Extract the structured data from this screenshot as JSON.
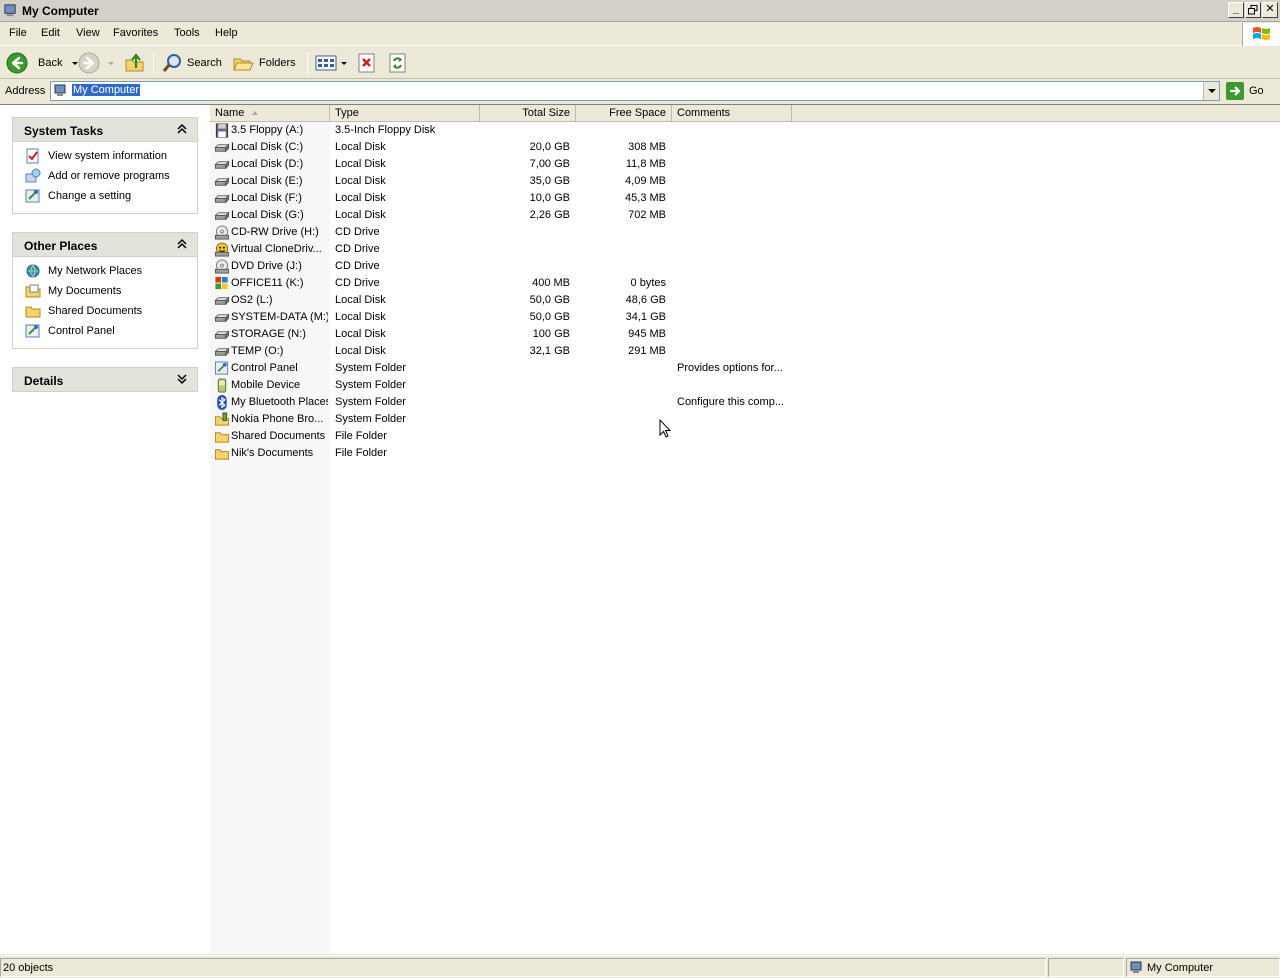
{
  "window": {
    "title": "My Computer"
  },
  "menu": [
    "File",
    "Edit",
    "View",
    "Favorites",
    "Tools",
    "Help"
  ],
  "toolbar": {
    "back_label": "Back",
    "search_label": "Search",
    "folders_label": "Folders"
  },
  "address": {
    "label": "Address",
    "value": "My Computer",
    "go_label": "Go"
  },
  "taskpane": {
    "system_tasks": {
      "title": "System Tasks",
      "links": [
        "View system information",
        "Add or remove programs",
        "Change a setting"
      ]
    },
    "other_places": {
      "title": "Other Places",
      "links": [
        "My Network Places",
        "My Documents",
        "Shared Documents",
        "Control Panel"
      ]
    },
    "details": {
      "title": "Details"
    }
  },
  "columns": {
    "name": "Name",
    "type": "Type",
    "total": "Total Size",
    "free": "Free Space",
    "comments": "Comments"
  },
  "items": [
    {
      "name": "3.5 Floppy (A:)",
      "type": "3.5-Inch Floppy Disk",
      "total": "",
      "free": "",
      "comments": "",
      "icon": "floppy-icon"
    },
    {
      "name": "Local Disk (C:)",
      "type": "Local Disk",
      "total": "20,0 GB",
      "free": "308 MB",
      "comments": "",
      "icon": "hard-disk-icon"
    },
    {
      "name": "Local Disk (D:)",
      "type": "Local Disk",
      "total": "7,00 GB",
      "free": "11,8 MB",
      "comments": "",
      "icon": "hard-disk-icon"
    },
    {
      "name": "Local Disk (E:)",
      "type": "Local Disk",
      "total": "35,0 GB",
      "free": "4,09 MB",
      "comments": "",
      "icon": "hard-disk-icon"
    },
    {
      "name": "Local Disk (F:)",
      "type": "Local Disk",
      "total": "10,0 GB",
      "free": "45,3 MB",
      "comments": "",
      "icon": "hard-disk-icon"
    },
    {
      "name": "Local Disk (G:)",
      "type": "Local Disk",
      "total": "2,26 GB",
      "free": "702 MB",
      "comments": "",
      "icon": "hard-disk-icon"
    },
    {
      "name": "CD-RW Drive (H:)",
      "type": "CD Drive",
      "total": "",
      "free": "",
      "comments": "",
      "icon": "cd-drive-icon"
    },
    {
      "name": "Virtual CloneDriv...",
      "type": "CD Drive",
      "total": "",
      "free": "",
      "comments": "",
      "icon": "virtual-drive-icon"
    },
    {
      "name": "DVD Drive (J:)",
      "type": "CD Drive",
      "total": "",
      "free": "",
      "comments": "",
      "icon": "cd-drive-icon"
    },
    {
      "name": "OFFICE11 (K:)",
      "type": "CD Drive",
      "total": "400 MB",
      "free": "0 bytes",
      "comments": "",
      "icon": "office-cd-icon"
    },
    {
      "name": "OS2 (L:)",
      "type": "Local Disk",
      "total": "50,0 GB",
      "free": "48,6 GB",
      "comments": "",
      "icon": "hard-disk-icon"
    },
    {
      "name": "SYSTEM-DATA (M:)",
      "type": "Local Disk",
      "total": "50,0 GB",
      "free": "34,1 GB",
      "comments": "",
      "icon": "hard-disk-icon"
    },
    {
      "name": "STORAGE (N:)",
      "type": "Local Disk",
      "total": "100 GB",
      "free": "945 MB",
      "comments": "",
      "icon": "hard-disk-icon"
    },
    {
      "name": "TEMP (O:)",
      "type": "Local Disk",
      "total": "32,1 GB",
      "free": "291 MB",
      "comments": "",
      "icon": "hard-disk-icon"
    },
    {
      "name": "Control Panel",
      "type": "System Folder",
      "total": "",
      "free": "",
      "comments": "Provides options for...",
      "icon": "control-panel-icon"
    },
    {
      "name": "Mobile Device",
      "type": "System Folder",
      "total": "",
      "free": "",
      "comments": "",
      "icon": "mobile-device-icon"
    },
    {
      "name": "My Bluetooth Places",
      "type": "System Folder",
      "total": "",
      "free": "",
      "comments": "Configure this comp...",
      "icon": "bluetooth-icon"
    },
    {
      "name": "Nokia Phone Bro...",
      "type": "System Folder",
      "total": "",
      "free": "",
      "comments": "",
      "icon": "phone-browser-icon"
    },
    {
      "name": "Shared Documents",
      "type": "File Folder",
      "total": "",
      "free": "",
      "comments": "",
      "icon": "folder-icon"
    },
    {
      "name": "Nik's Documents",
      "type": "File Folder",
      "total": "",
      "free": "",
      "comments": "",
      "icon": "folder-icon"
    }
  ],
  "status": {
    "objects": "20 objects",
    "location": "My Computer"
  }
}
